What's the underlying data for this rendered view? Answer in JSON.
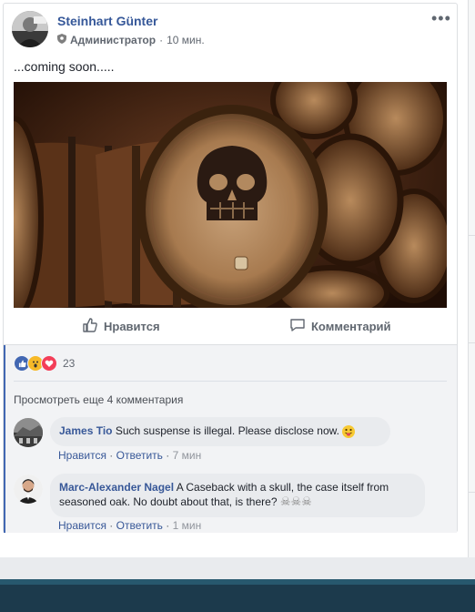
{
  "post": {
    "author": "Steinhart Günter",
    "role": "Администратор",
    "separator": "·",
    "time": "10 мин.",
    "more_icon": "•••",
    "text": "...coming soon.....",
    "like_label": "Нравится",
    "comment_label": "Комментарий"
  },
  "reactions": {
    "types": [
      "like-icon",
      "wow-icon",
      "love-icon"
    ],
    "count": "23",
    "colors": {
      "like": "#4267b2",
      "wow": "#f7b928",
      "love": "#f33e58"
    }
  },
  "comments": {
    "view_more": "Просмотреть еще 4 комментария",
    "items": [
      {
        "name": "James Tio",
        "text": "Such suspense is illegal. Please disclose now.",
        "emoji": "tongue-out-emoji",
        "like": "Нравится",
        "reply": "Ответить",
        "sep": "·",
        "time": "7 мин"
      },
      {
        "name": "Marc-Alexander Nagel",
        "text_line1": "A Caseback with a skull, the case itself from",
        "text_line2": "seasoned oak. No doubt about that, is there?",
        "emoji_glyphs": "☠☠☠",
        "like": "Нравится",
        "reply": "Ответить",
        "sep": "·",
        "time": "1 мин"
      }
    ]
  },
  "theme": {
    "link": "#365899",
    "meta": "#616770",
    "accent": "#4267b2"
  }
}
